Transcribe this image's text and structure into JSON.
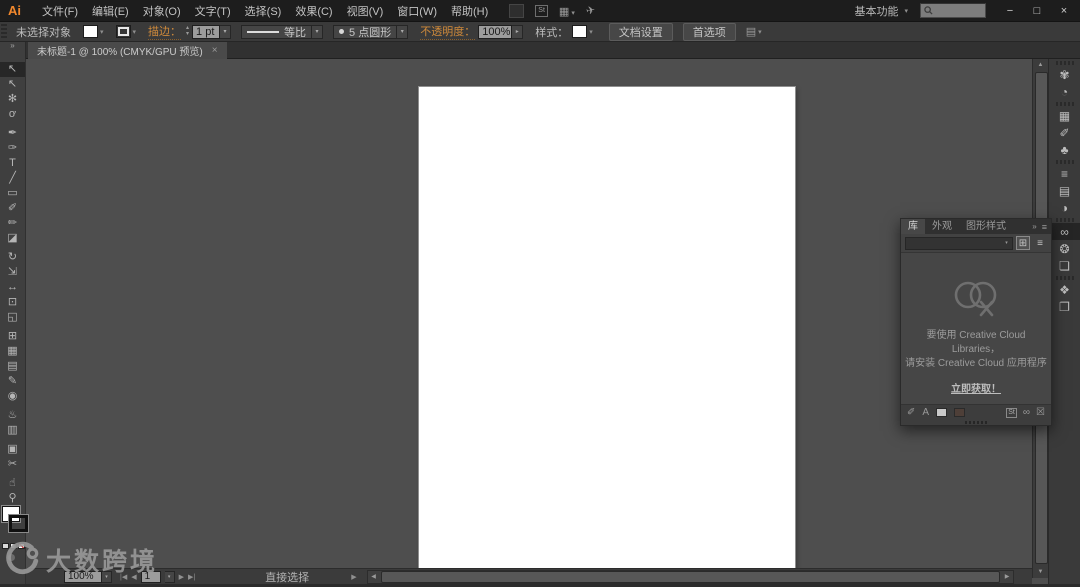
{
  "titlebar": {
    "logo": "Ai",
    "menus": [
      {
        "name": "menu-file",
        "label": "文件(F)"
      },
      {
        "name": "menu-edit",
        "label": "编辑(E)"
      },
      {
        "name": "menu-object",
        "label": "对象(O)"
      },
      {
        "name": "menu-type",
        "label": "文字(T)"
      },
      {
        "name": "menu-select",
        "label": "选择(S)"
      },
      {
        "name": "menu-effect",
        "label": "效果(C)"
      },
      {
        "name": "menu-view",
        "label": "视图(V)"
      },
      {
        "name": "menu-window",
        "label": "窗口(W)"
      },
      {
        "name": "menu-help",
        "label": "帮助(H)"
      }
    ],
    "stock_label": "St",
    "workspace": "基本功能",
    "window": {
      "minimize": "−",
      "maximize": "□",
      "close": "×"
    }
  },
  "icons": {
    "caret": "▾",
    "caret_right": "▸",
    "step_up": "▴",
    "step_down": "▾",
    "chevron_double": "»",
    "up": "▲",
    "down": "▼",
    "left": "◀",
    "right": "▶",
    "first": "|◀",
    "prev": "◀",
    "next": "▶",
    "last": "▶|",
    "panel_menu": "≡",
    "close": "×",
    "grid": "⊞",
    "list": "≡",
    "arrange": "▦",
    "gpu": "✈"
  },
  "control_bar": {
    "no_selection": "未选择对象",
    "stroke_label": "描边：",
    "stroke_weight": "1 pt",
    "variable_width_profile": "等比",
    "brush_definition": "5 点圆形",
    "opacity_label": "不透明度：",
    "opacity_value": "100%",
    "style_label": "样式：",
    "document_setup": "文档设置",
    "preferences": "首选项",
    "panel_menu_glyph": "▤"
  },
  "document_tab": {
    "title": "未标题-1 @ 100% (CMYK/GPU 预览)"
  },
  "toolbar": {
    "tools": [
      {
        "name": "selection-tool",
        "glyph": "↖",
        "selected": true
      },
      {
        "name": "direct-selection-tool",
        "glyph": "↖"
      },
      {
        "name": "magic-wand-tool",
        "glyph": "✻"
      },
      {
        "name": "lasso-tool",
        "glyph": "ơ"
      },
      {
        "sep": true
      },
      {
        "name": "pen-tool",
        "glyph": "✒"
      },
      {
        "name": "curvature-tool",
        "glyph": "✑"
      },
      {
        "name": "type-tool",
        "glyph": "T"
      },
      {
        "name": "line-segment-tool",
        "glyph": "╱"
      },
      {
        "name": "rectangle-tool",
        "glyph": "▭"
      },
      {
        "name": "paintbrush-tool",
        "glyph": "✐"
      },
      {
        "name": "pencil-tool",
        "glyph": "✏"
      },
      {
        "name": "eraser-tool",
        "glyph": "◪"
      },
      {
        "sep": true
      },
      {
        "name": "rotate-tool",
        "glyph": "↻"
      },
      {
        "name": "scale-tool",
        "glyph": "⇲"
      },
      {
        "name": "width-tool",
        "glyph": "↔"
      },
      {
        "name": "free-transform-tool",
        "glyph": "⊡"
      },
      {
        "name": "shape-builder-tool",
        "glyph": "◱"
      },
      {
        "sep": true
      },
      {
        "name": "perspective-grid-tool",
        "glyph": "⊞"
      },
      {
        "name": "mesh-tool",
        "glyph": "▦"
      },
      {
        "name": "gradient-tool",
        "glyph": "▤"
      },
      {
        "name": "eyedropper-tool",
        "glyph": "✎"
      },
      {
        "name": "blend-tool",
        "glyph": "◉"
      },
      {
        "sep": true
      },
      {
        "name": "symbol-sprayer-tool",
        "glyph": "♨"
      },
      {
        "name": "column-graph-tool",
        "glyph": "▥"
      },
      {
        "sep": true
      },
      {
        "name": "artboard-tool",
        "glyph": "▣"
      },
      {
        "name": "slice-tool",
        "glyph": "✂"
      },
      {
        "sep": true
      },
      {
        "name": "hand-tool",
        "glyph": "☝"
      },
      {
        "name": "zoom-tool",
        "glyph": "⚲"
      }
    ]
  },
  "dock": {
    "icons": [
      {
        "grip": true
      },
      {
        "name": "color-panel-icon",
        "glyph": "✾"
      },
      {
        "name": "color-guide-panel-icon",
        "glyph": "◔"
      },
      {
        "grip": true
      },
      {
        "name": "swatches-panel-icon",
        "glyph": "▦"
      },
      {
        "name": "brushes-panel-icon",
        "glyph": "✐"
      },
      {
        "name": "symbols-panel-icon",
        "glyph": "♣"
      },
      {
        "grip": true
      },
      {
        "name": "stroke-panel-icon",
        "glyph": "≡"
      },
      {
        "name": "gradient-panel-icon",
        "glyph": "▤"
      },
      {
        "name": "transparency-panel-icon",
        "glyph": "◑"
      },
      {
        "grip": true
      },
      {
        "name": "libraries-panel-icon",
        "glyph": "∞",
        "selected": true
      },
      {
        "name": "color-themes-panel-icon",
        "glyph": "❂"
      },
      {
        "name": "asset-export-panel-icon",
        "glyph": "❏"
      },
      {
        "grip": true
      },
      {
        "name": "layers-panel-icon",
        "glyph": "❖"
      },
      {
        "name": "artboards-panel-icon",
        "glyph": "❐"
      }
    ]
  },
  "panel": {
    "tabs": [
      {
        "name": "tab-libraries",
        "label": "库",
        "active": true
      },
      {
        "name": "tab-appearance",
        "label": "外观"
      },
      {
        "name": "tab-graphic-styles",
        "label": "图形样式"
      }
    ],
    "combobox_value": "",
    "message_line1": "要使用 Creative Cloud Libraries，",
    "message_line2": "请安装 Creative Cloud 应用程序",
    "get_link": "立即获取！",
    "footer": {
      "brush": "✐",
      "char": "A",
      "st": "St",
      "sync": "∞",
      "trash": "☒"
    }
  },
  "status_bar": {
    "zoom": "100%",
    "artboard": "1",
    "tool_name": "直接选择"
  },
  "watermark": {
    "text": "大数跨境"
  },
  "colors": {
    "logo_orange": "#f0872c",
    "control_link_orange": "#cf8a3b",
    "artboard_white": "#ffffff",
    "ui_dark": "#3a3a3a",
    "titlebar": "#1d1d1d"
  }
}
